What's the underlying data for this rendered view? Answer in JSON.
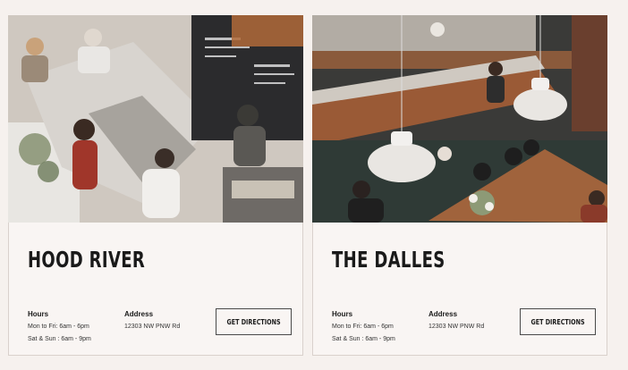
{
  "locations": [
    {
      "name": "HOOD RIVER",
      "hours_label": "Hours",
      "hours_lines": [
        "Mon to Fri: 6am - 6pm",
        "Sat & Sun : 6am - 9pm"
      ],
      "address_label": "Address",
      "address": "12303 NW PNW Rd",
      "button_label": "GET DIRECTIONS"
    },
    {
      "name": "THE DALLES",
      "hours_label": "Hours",
      "hours_lines": [
        "Mon to Fri: 6am - 6pm",
        "Sat & Sun : 6am - 9pm"
      ],
      "address_label": "Address",
      "address": "12303 NW PNW Rd",
      "button_label": "GET DIRECTIONS"
    }
  ]
}
